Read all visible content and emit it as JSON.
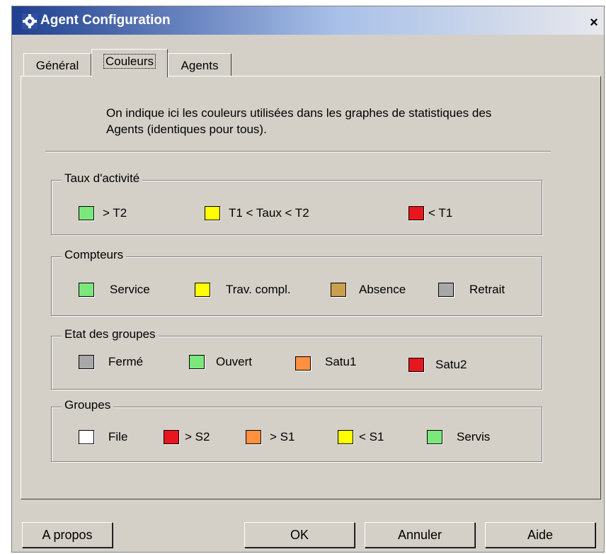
{
  "window": {
    "title": "Agent Configuration",
    "close": "×"
  },
  "tabs": [
    "Général",
    "Couleurs",
    "Agents"
  ],
  "intro": "On indique ici les couleurs utilisées dans les graphes de statistiques des Agents (identiques pour tous).",
  "groups": [
    {
      "title": "Taux d'activité",
      "items": [
        {
          "label": "> T2",
          "color": "#7ce87c"
        },
        {
          "label": "T1 < Taux < T2",
          "color": "#ffff00"
        },
        {
          "label": "< T1",
          "color": "#e8161e"
        }
      ]
    },
    {
      "title": "Compteurs",
      "items": [
        {
          "label": "Service",
          "color": "#7ce87c"
        },
        {
          "label": "Trav. compl.",
          "color": "#ffff00"
        },
        {
          "label": "Absence",
          "color": "#c8a050"
        },
        {
          "label": "Retrait",
          "color": "#a8a8a8"
        }
      ]
    },
    {
      "title": "Etat des groupes",
      "items": [
        {
          "label": "Fermé",
          "color": "#a8a8a8"
        },
        {
          "label": "Ouvert",
          "color": "#7ce87c"
        },
        {
          "label": "Satu1",
          "color": "#ff9040"
        },
        {
          "label": "Satu2",
          "color": "#e8161e"
        }
      ]
    },
    {
      "title": "Groupes",
      "items": [
        {
          "label": "File",
          "color": "#ffffff"
        },
        {
          "label": "> S2",
          "color": "#e8161e"
        },
        {
          "label": "> S1",
          "color": "#ff9040"
        },
        {
          "label": "< S1",
          "color": "#ffff00"
        },
        {
          "label": "Servis",
          "color": "#7ce87c"
        }
      ]
    }
  ],
  "buttons": {
    "about": "A propos",
    "ok": "OK",
    "cancel": "Annuler",
    "help": "Aide"
  }
}
